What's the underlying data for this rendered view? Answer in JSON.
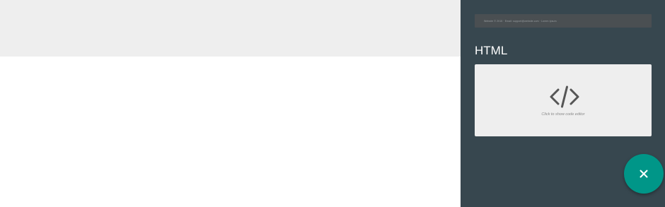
{
  "footer_preview": {
    "text": "Website © 2015 · Email: support@website.com · Lorem Ipsum"
  },
  "html_section": {
    "heading": "HTML",
    "hint": "Click to show code editor",
    "icon": "code-icon"
  },
  "fab": {
    "icon": "close-icon",
    "color": "#009688"
  },
  "colors": {
    "panel_bg": "#37474f",
    "top_band": "#eeeeee",
    "card_bg": "#eeeeee",
    "accent": "#009688"
  }
}
